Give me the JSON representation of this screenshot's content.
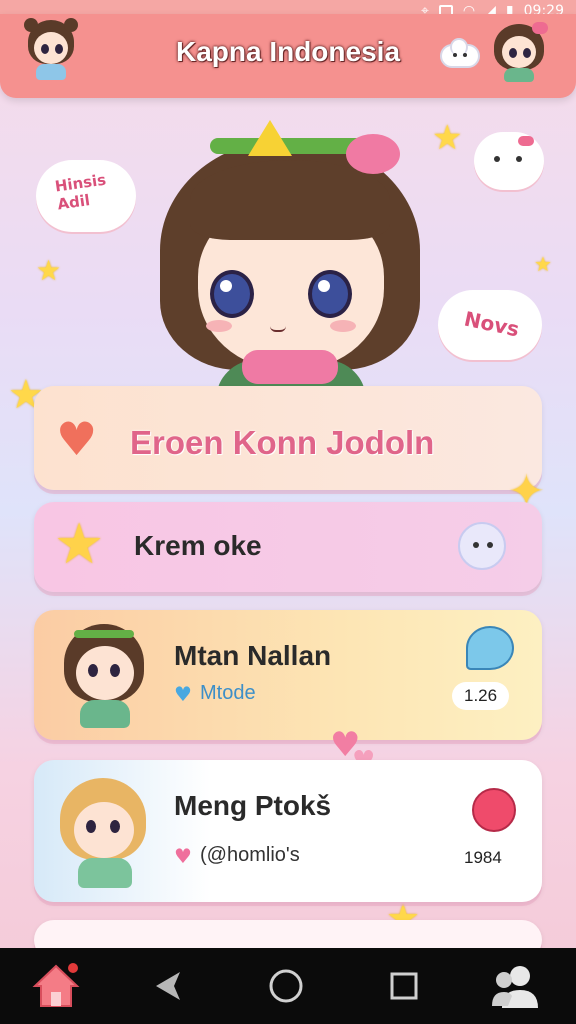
{
  "status_bar": {
    "time": "09:29"
  },
  "header": {
    "title": "Kapna Indonesia"
  },
  "decor": {
    "cloud_left_text": "Hinsis\nAdil",
    "cloud_right_text": "Novs"
  },
  "cards": {
    "primary": {
      "label": "Eroen Konn Jodoln"
    },
    "second": {
      "label": "Krem oke"
    },
    "chat1": {
      "name": "Mtan Nallan",
      "subtitle": "Mtode",
      "count": "1.26"
    },
    "chat2": {
      "name": "Meng Ptokš",
      "subtitle": "(@homlio's",
      "count": "1984"
    }
  },
  "colors": {
    "accent": "#f5918f",
    "pink_text": "#e0658a",
    "nav_bg": "#0b0b0b"
  },
  "icons": [
    "wifi-icon",
    "signal-icon",
    "battery-icon",
    "heart-icon",
    "star-icon",
    "home-icon",
    "back-icon",
    "circle-home-icon",
    "recents-icon",
    "profile-icon"
  ]
}
